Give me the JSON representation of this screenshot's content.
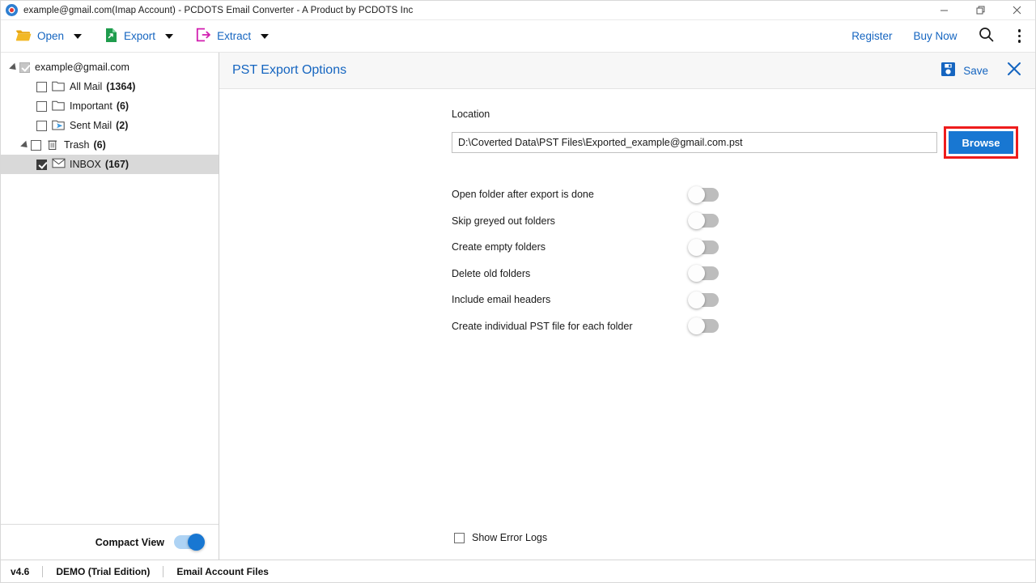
{
  "window": {
    "title": "example@gmail.com(Imap Account) - PCDOTS Email Converter - A Product by PCDOTS Inc",
    "app_icon": "record-circle-icon",
    "minimize": "minimize-icon",
    "restore": "restore-icon",
    "close": "close-icon"
  },
  "toolbar": {
    "items": [
      {
        "label": "Open",
        "icon": "open-folder-icon",
        "caret": "chevron-down-icon"
      },
      {
        "label": "Export",
        "icon": "export-document-icon",
        "caret": "chevron-down-icon"
      },
      {
        "label": "Extract",
        "icon": "extract-arrow-icon",
        "caret": "chevron-down-icon"
      }
    ],
    "register_label": "Register",
    "buy_now_label": "Buy Now",
    "search_icon": "search-icon",
    "menu_icon": "kebab-menu-icon"
  },
  "sidebar": {
    "tree": [
      {
        "label": "example@gmail.com",
        "count": "",
        "checked": "grey",
        "icon": "",
        "twisty": true,
        "indent": 0,
        "selected": false
      },
      {
        "label": "All Mail",
        "count": "(1364)",
        "checked": "none",
        "icon": "folder-icon",
        "twisty": false,
        "indent": 1,
        "selected": false
      },
      {
        "label": "Important",
        "count": "(6)",
        "checked": "none",
        "icon": "folder-icon",
        "twisty": false,
        "indent": 1,
        "selected": false
      },
      {
        "label": "Sent Mail",
        "count": "(2)",
        "checked": "none",
        "icon": "sent-folder-icon",
        "twisty": false,
        "indent": 1,
        "selected": false
      },
      {
        "label": "Trash",
        "count": "(6)",
        "checked": "none",
        "icon": "trash-icon",
        "twisty": true,
        "indent": 1,
        "selected": false
      },
      {
        "label": "INBOX",
        "count": "(167)",
        "checked": "checked",
        "icon": "envelope-icon",
        "twisty": false,
        "indent": 2,
        "selected": true
      }
    ],
    "compact_view_label": "Compact View",
    "compact_view_on": true
  },
  "panel": {
    "title": "PST Export Options",
    "save_label": "Save",
    "save_icon": "floppy-save-icon",
    "close_icon": "close-x-icon",
    "location_label": "Location",
    "location_value": "D:\\Coverted Data\\PST Files\\Exported_example@gmail.com.pst",
    "browse_label": "Browse",
    "options": [
      {
        "label": "Open folder after export is done",
        "on": false
      },
      {
        "label": "Skip greyed out folders",
        "on": false
      },
      {
        "label": "Create empty folders",
        "on": false
      },
      {
        "label": "Delete old folders",
        "on": false
      },
      {
        "label": "Include email headers",
        "on": false
      },
      {
        "label": "Create individual PST file for each folder",
        "on": false
      }
    ],
    "error_logs_label": "Show Error Logs",
    "error_logs_checked": false
  },
  "statusbar": {
    "version": "v4.6",
    "edition": "DEMO (Trial Edition)",
    "mode": "Email Account Files"
  },
  "colors": {
    "accent": "#1565c0",
    "button_blue": "#1877d2",
    "highlight_red": "#ee1c1c",
    "selection_grey": "#d9d9d9"
  }
}
